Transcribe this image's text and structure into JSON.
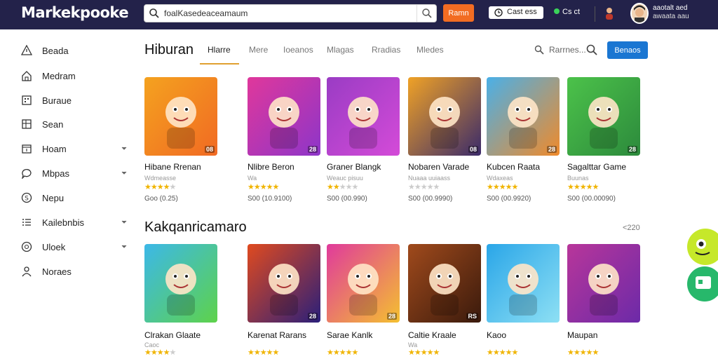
{
  "app": {
    "logo": "Markekpooke",
    "search_value": "foalKasedeaceamaum",
    "search_button": "Ramn",
    "balance": "Cast ess",
    "status": "Cs ct",
    "user_name": "aaotalt aed",
    "user_sub": "awaata aau",
    "accent": "#f26c22",
    "primary": "#1a76d2",
    "topbar_color": "#23224a"
  },
  "sidebar": {
    "items": [
      {
        "label": "Beada",
        "icon": "alert-icon",
        "chevron": false
      },
      {
        "label": "Medram",
        "icon": "home-icon",
        "chevron": false
      },
      {
        "label": "Buraue",
        "icon": "grid-icon",
        "chevron": false
      },
      {
        "label": "Sean",
        "icon": "box-icon",
        "chevron": false
      },
      {
        "label": "Hoam",
        "icon": "calendar-icon",
        "chevron": true
      },
      {
        "label": "Mbpas",
        "icon": "chat-icon",
        "chevron": true
      },
      {
        "label": "Nepu",
        "icon": "coin-icon",
        "chevron": false
      },
      {
        "label": "Kailebnbis",
        "icon": "list-icon",
        "chevron": true
      },
      {
        "label": "Uloek",
        "icon": "circle-icon",
        "chevron": true
      },
      {
        "label": "Noraes",
        "icon": "person-icon",
        "chevron": false
      }
    ]
  },
  "main": {
    "title": "Hiburan",
    "tabs": [
      {
        "label": "Hlarre",
        "active": true
      },
      {
        "label": "Mere",
        "active": false
      },
      {
        "label": "Ioeanos",
        "active": false
      },
      {
        "label": "Mlagas",
        "active": false
      },
      {
        "label": "Rradias",
        "active": false
      },
      {
        "label": "Mledes",
        "active": false
      }
    ],
    "filter_label": "Rarrnes...",
    "action_button": "Benaos",
    "section2_title": "Kakqanricamaro",
    "section2_count": "<220"
  },
  "row1": [
    {
      "title": "Hibane Rrenan",
      "sub": "Wdmeasse",
      "rating": 4,
      "price": "Goo (0.25)",
      "badge": "08",
      "colors": [
        "#f4a21f",
        "#f16a23"
      ]
    },
    {
      "title": "Nlibre Beron",
      "sub": "Wa",
      "rating": 5,
      "price": "S00 (10.9100)",
      "badge": "28",
      "colors": [
        "#e0379b",
        "#8d36c9"
      ]
    },
    {
      "title": "Graner Blangk",
      "sub": "Weauc pisuu",
      "rating": 2,
      "price": "S00 (00.990)",
      "badge": "",
      "colors": [
        "#9a3cc4",
        "#d44bd8"
      ]
    },
    {
      "title": "Nobaren Varade",
      "sub": "Nuaaa uuiaass",
      "rating": 0,
      "price": "S00 (00.9990)",
      "badge": "08",
      "colors": [
        "#f0a226",
        "#3a2a6a"
      ]
    },
    {
      "title": "Kubcen Raata",
      "sub": "Wdaxeas",
      "rating": 5,
      "price": "S00 (00.9920)",
      "badge": "28",
      "colors": [
        "#4ab0e8",
        "#f08a2a"
      ]
    },
    {
      "title": "Sagalttar Game",
      "sub": "Buunas",
      "rating": 5,
      "price": "S00 (00.00090)",
      "badge": "28",
      "colors": [
        "#4cc24a",
        "#2c8a3c"
      ]
    }
  ],
  "row2": [
    {
      "title": "Clrakan Glaate",
      "sub": "Caoc",
      "rating": 4,
      "price": "",
      "badge": "",
      "colors": [
        "#3cb8e8",
        "#5ed24a"
      ]
    },
    {
      "title": "Karenat Rarans",
      "sub": "",
      "rating": 5,
      "price": "",
      "badge": "28",
      "colors": [
        "#e04a1f",
        "#2a1f7a"
      ]
    },
    {
      "title": "Sarae Kanlk",
      "sub": "",
      "rating": 5,
      "price": "",
      "badge": "28",
      "colors": [
        "#e03a9c",
        "#f4c030"
      ]
    },
    {
      "title": "Caltie Kraale",
      "sub": "Wa",
      "rating": 5,
      "price": "",
      "badge": "RS",
      "colors": [
        "#a04a1c",
        "#3a1a0c"
      ]
    },
    {
      "title": "Kaoo",
      "sub": "",
      "rating": 5,
      "price": "",
      "badge": "",
      "colors": [
        "#2aa6e8",
        "#8ee0f4"
      ]
    },
    {
      "title": "Maupan",
      "sub": "",
      "rating": 5,
      "price": "",
      "badge": "",
      "colors": [
        "#b8369a",
        "#6c2aa8"
      ]
    }
  ]
}
